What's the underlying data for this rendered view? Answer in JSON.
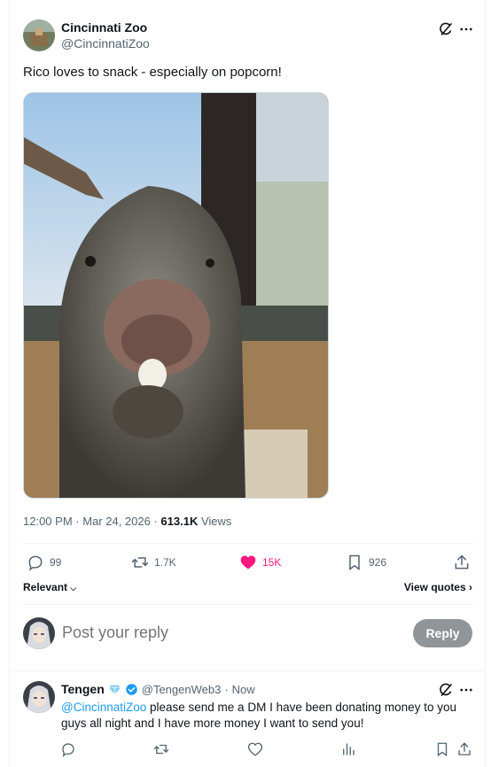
{
  "tweet": {
    "author_name": "Cincinnati Zoo",
    "author_handle": "@CincinnatiZoo",
    "text": "Rico loves to snack - especially on popcorn!",
    "time": "12:00 PM",
    "date": "Mar 24, 2026",
    "views_count": "613.1K",
    "views_label": "Views",
    "replies": "99",
    "reposts": "1.7K",
    "likes": "15K",
    "bookmarks": "926",
    "image_subject": "porcupine-eating-popcorn"
  },
  "controls": {
    "relevant_label": "Relevant",
    "view_quotes_label": "View quotes",
    "reply_placeholder": "Post your reply",
    "reply_button": "Reply"
  },
  "reply": {
    "author_name": "Tengen",
    "author_handle": "@TengenWeb3",
    "time": "Now",
    "mention": "@CincinnatiZoo",
    "text": " please send me a DM I have been donating money to you guys all night and I have more money I want to send you!"
  },
  "colors": {
    "like_active": "#f91880",
    "link": "#1d9bf0",
    "muted": "#536471",
    "reply_button_bg": "#8f9599",
    "verified": "#1d9bf0"
  },
  "icons": [
    "grok-icon",
    "more-icon",
    "reply-icon",
    "repost-icon",
    "heart-icon",
    "bookmark-icon",
    "share-icon",
    "chevron-down-icon",
    "chevron-right-icon",
    "diamond-icon",
    "verified-icon",
    "views-icon"
  ]
}
